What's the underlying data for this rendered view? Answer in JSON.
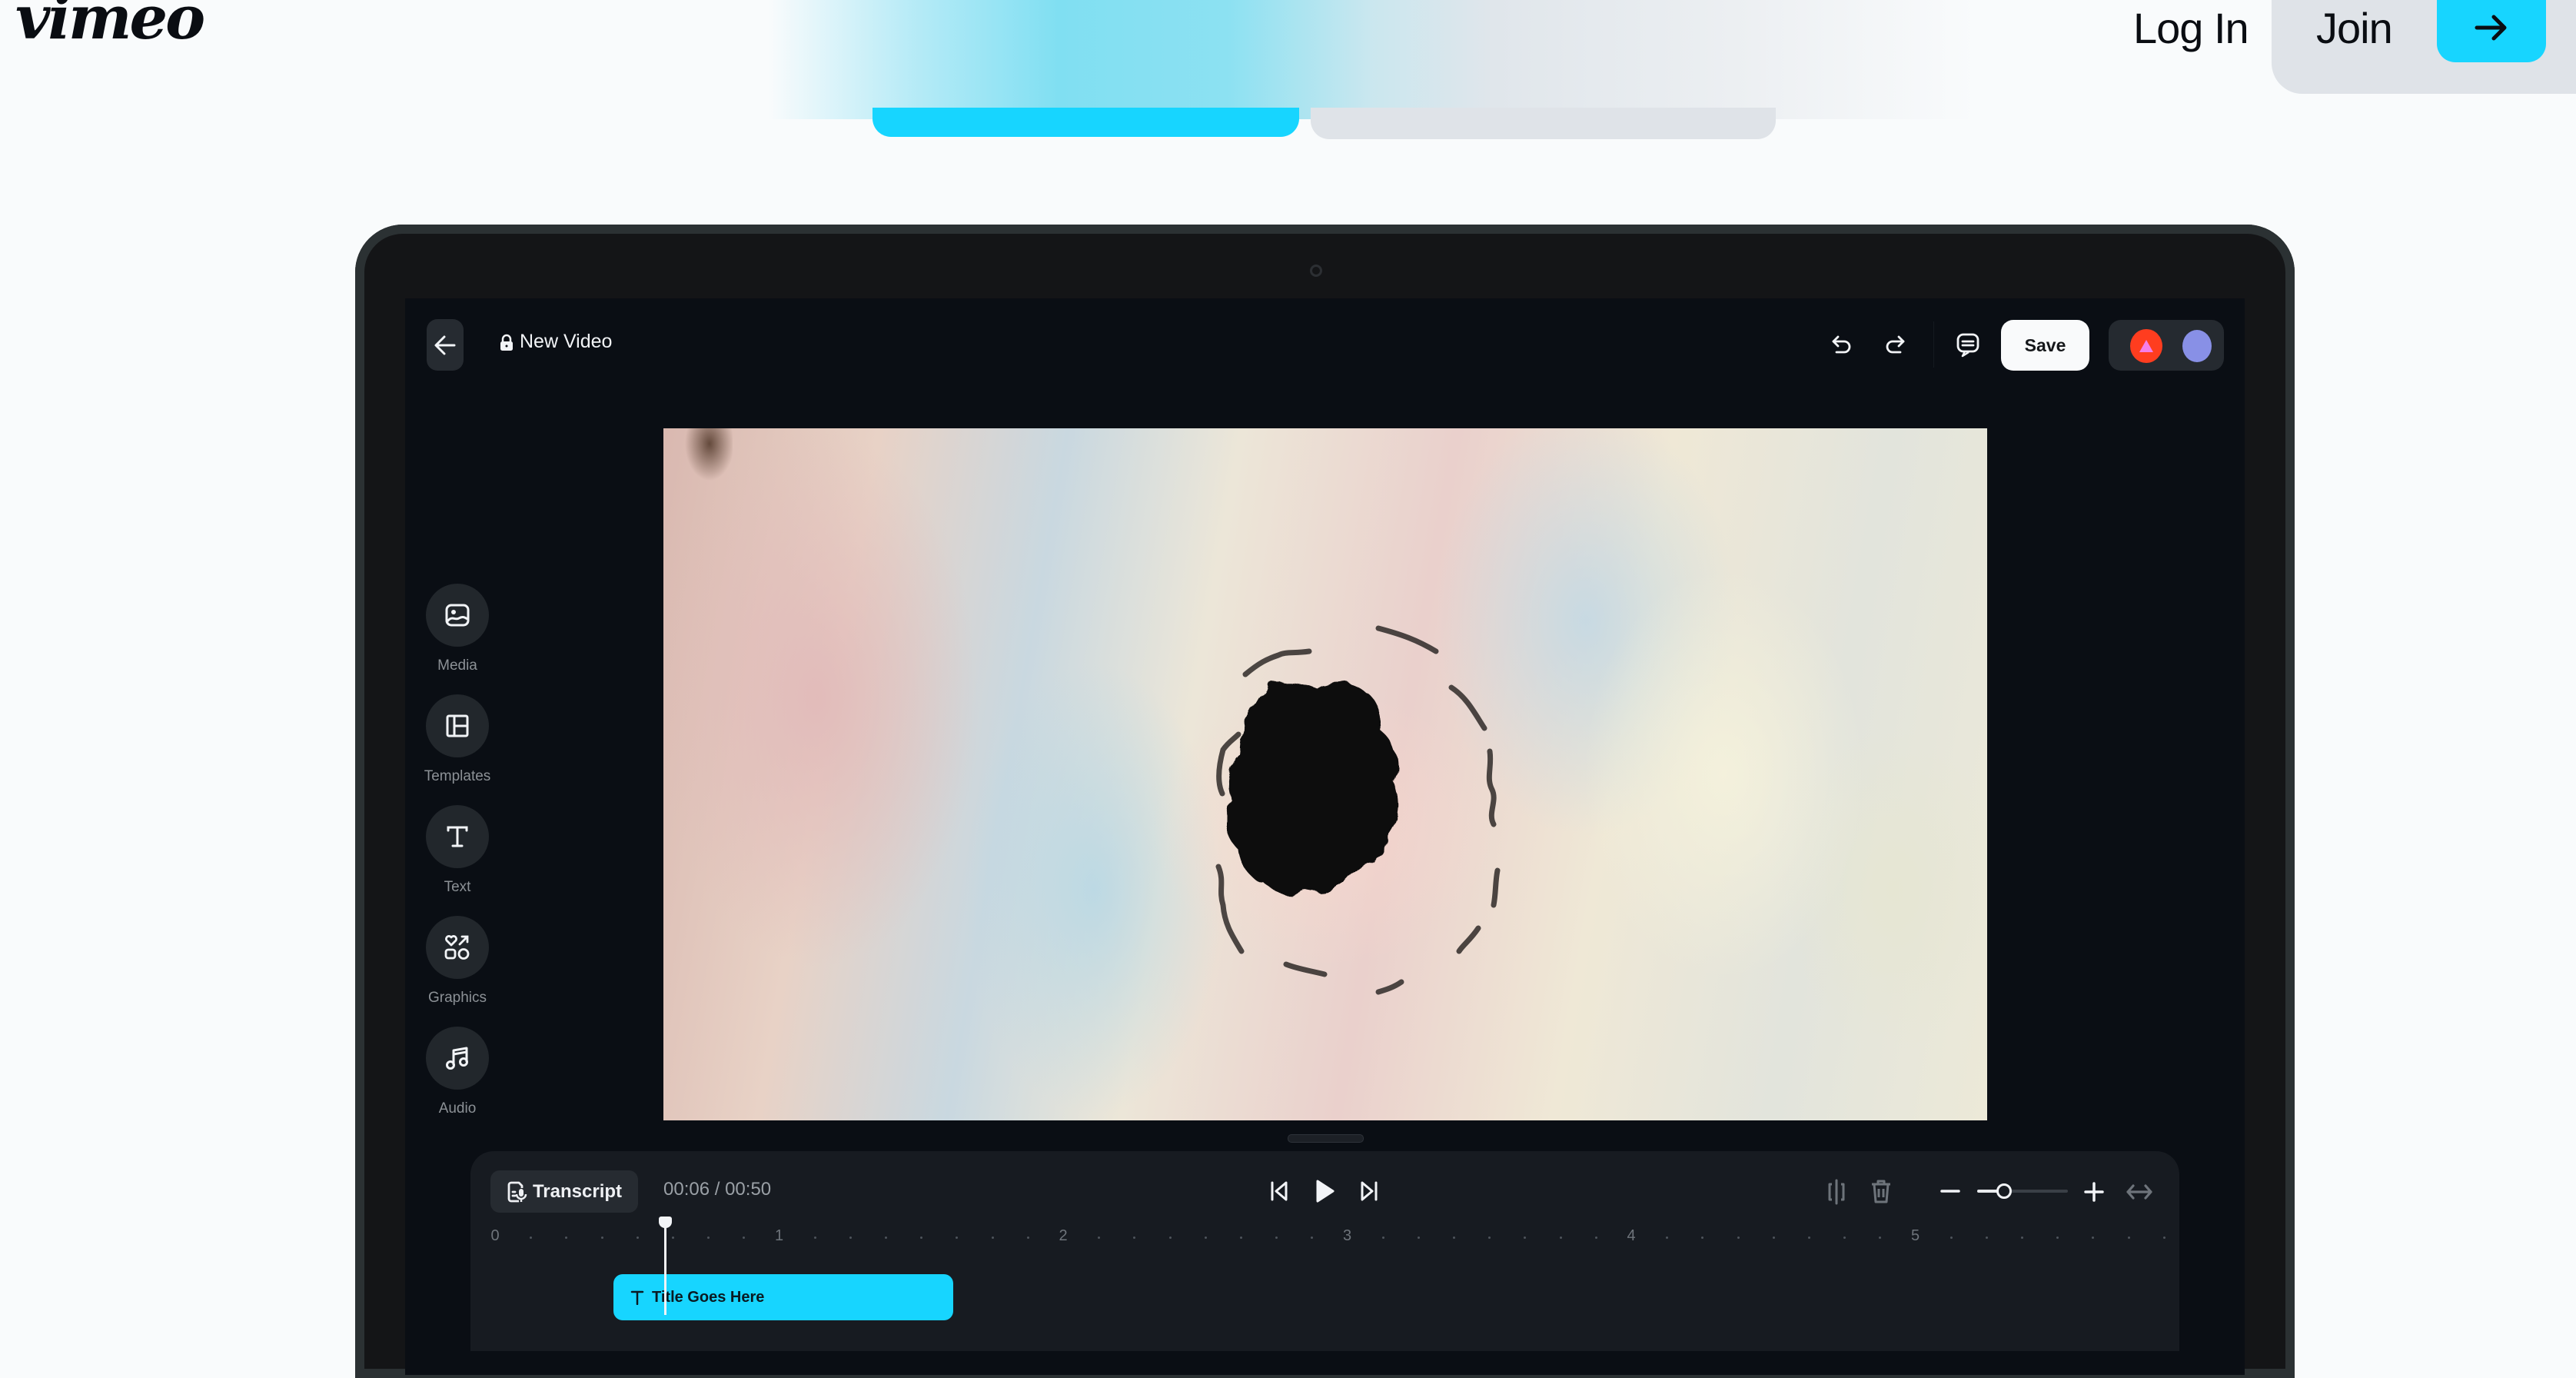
{
  "site": {
    "logo": "vimeo",
    "nav": {
      "login_label": "Log In",
      "join_label": "Join",
      "join_arrow_icon": "arrow-right-icon"
    },
    "colors": {
      "accent": "#17d5ff",
      "page_bg": "#f9fbfc",
      "pill_gray": "#dfe3e8"
    }
  },
  "editor": {
    "topbar": {
      "back_icon": "arrow-left-icon",
      "lock_icon": "lock-icon",
      "project_title": "New Video",
      "undo_icon": "undo-icon",
      "redo_icon": "redo-icon",
      "comments_icon": "comment-icon",
      "save_label": "Save",
      "collaborators": [
        {
          "name": "collaborator-1",
          "color": "#ff3d1f",
          "glyph_color": "#f57ee8"
        },
        {
          "name": "collaborator-2",
          "color": "#8890e6"
        }
      ]
    },
    "tools": [
      {
        "label": "Media",
        "icon": "image-icon"
      },
      {
        "label": "Templates",
        "icon": "layout-icon"
      },
      {
        "label": "Text",
        "icon": "text-icon"
      },
      {
        "label": "Graphics",
        "icon": "shapes-icon"
      },
      {
        "label": "Audio",
        "icon": "music-icon"
      }
    ],
    "timeline": {
      "transcript_label": "Transcript",
      "current_time": "00:06",
      "separator": "/",
      "duration": "00:50",
      "timecode": "00:06 / 00:50",
      "ruler_labels": [
        "0",
        "1",
        "2",
        "3",
        "4",
        "5"
      ],
      "playhead_seconds": 0.6,
      "zoom_level_fraction": 0.3,
      "clips": [
        {
          "label": "Title Goes Here",
          "icon": "text-icon",
          "type": "title",
          "color": "#17d5ff"
        }
      ]
    }
  }
}
